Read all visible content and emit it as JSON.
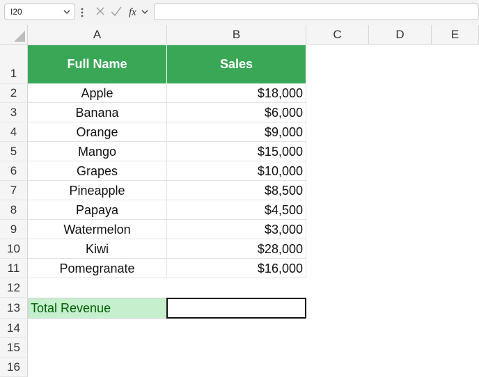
{
  "namebox": {
    "value": "I20"
  },
  "formula_bar": {
    "value": ""
  },
  "columns": [
    "A",
    "B",
    "C",
    "D",
    "E"
  ],
  "rows": [
    "1",
    "2",
    "3",
    "4",
    "5",
    "6",
    "7",
    "8",
    "9",
    "10",
    "11",
    "12",
    "13",
    "14",
    "15",
    "16"
  ],
  "table": {
    "headers": [
      "Full Name",
      "Sales"
    ],
    "rows": [
      [
        "Apple",
        "$18,000"
      ],
      [
        "Banana",
        "$6,000"
      ],
      [
        "Orange",
        "$9,000"
      ],
      [
        "Mango",
        "$15,000"
      ],
      [
        "Grapes",
        "$10,000"
      ],
      [
        "Pineapple",
        "$8,500"
      ],
      [
        "Papaya",
        "$4,500"
      ],
      [
        "Watermelon",
        "$3,000"
      ],
      [
        "Kiwi",
        "$28,000"
      ],
      [
        "Pomegranate",
        "$16,000"
      ]
    ]
  },
  "total": {
    "label": "Total Revenue",
    "value": ""
  },
  "colors": {
    "header_fill": "#3aa757",
    "total_fill": "#c6efce",
    "total_text": "#006100"
  }
}
